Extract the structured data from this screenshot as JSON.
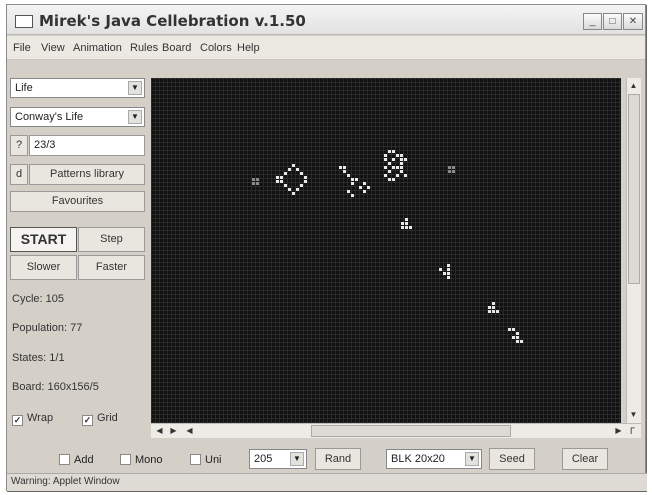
{
  "window": {
    "title": "Mirek's Java Cellebration v.1.50"
  },
  "menu": [
    "File",
    "View",
    "Animation",
    "Rules",
    "Board",
    "Colors",
    "Help"
  ],
  "sidebar": {
    "game_select": "Life",
    "rule_select": "Conway's Life",
    "rule_help_button": "?",
    "rule_text": "23/3",
    "d_button": "d",
    "patterns_button": "Patterns library",
    "favourites_button": "Favourites",
    "start_button": "START",
    "step_button": "Step",
    "slower_button": "Slower",
    "faster_button": "Faster",
    "cycle": "Cycle: 105",
    "population": "Population: 77",
    "states": "States: 1/1",
    "board": "Board: 160x156/5",
    "wrap_label": "Wrap",
    "grid_label": "Grid"
  },
  "bottom": {
    "add_label": "Add",
    "mono_label": "Mono",
    "uni_label": "Uni",
    "number_select": "205",
    "rand_button": "Rand",
    "blk_select": "BLK 20x20",
    "seed_button": "Seed",
    "clear_button": "Clear"
  },
  "status": "Warning: Applet Window",
  "colors": {
    "canvas_bg": "#111111",
    "live_cell": "#e8e8e8",
    "marker_cell": "#8a8a8a"
  }
}
